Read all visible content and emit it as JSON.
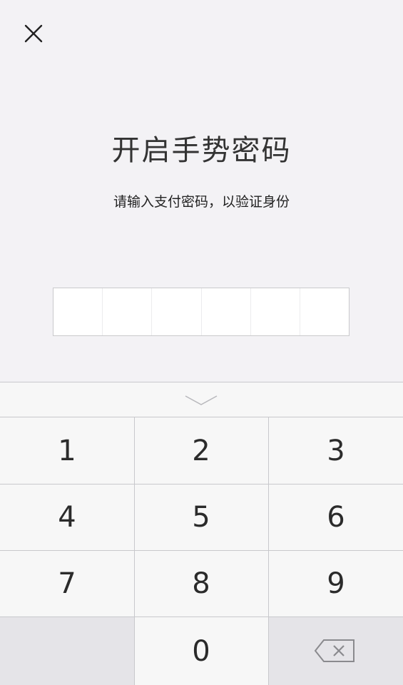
{
  "header": {
    "close_icon": "close-icon"
  },
  "title": "开启手势密码",
  "subtitle": "请输入支付密码，以验证身份",
  "pin": {
    "length": 6,
    "filled": 0
  },
  "keyboard": {
    "collapse_icon": "chevron-down-icon",
    "keys": [
      "1",
      "2",
      "3",
      "4",
      "5",
      "6",
      "7",
      "8",
      "9",
      "",
      "0",
      ""
    ],
    "backspace_icon": "backspace-icon"
  },
  "colors": {
    "background": "#f3f2f5",
    "keyboard_bg": "#f7f7f7",
    "keyboard_dark_key": "#e5e4e8",
    "divider": "#c8c8cc",
    "text": "#333333"
  }
}
